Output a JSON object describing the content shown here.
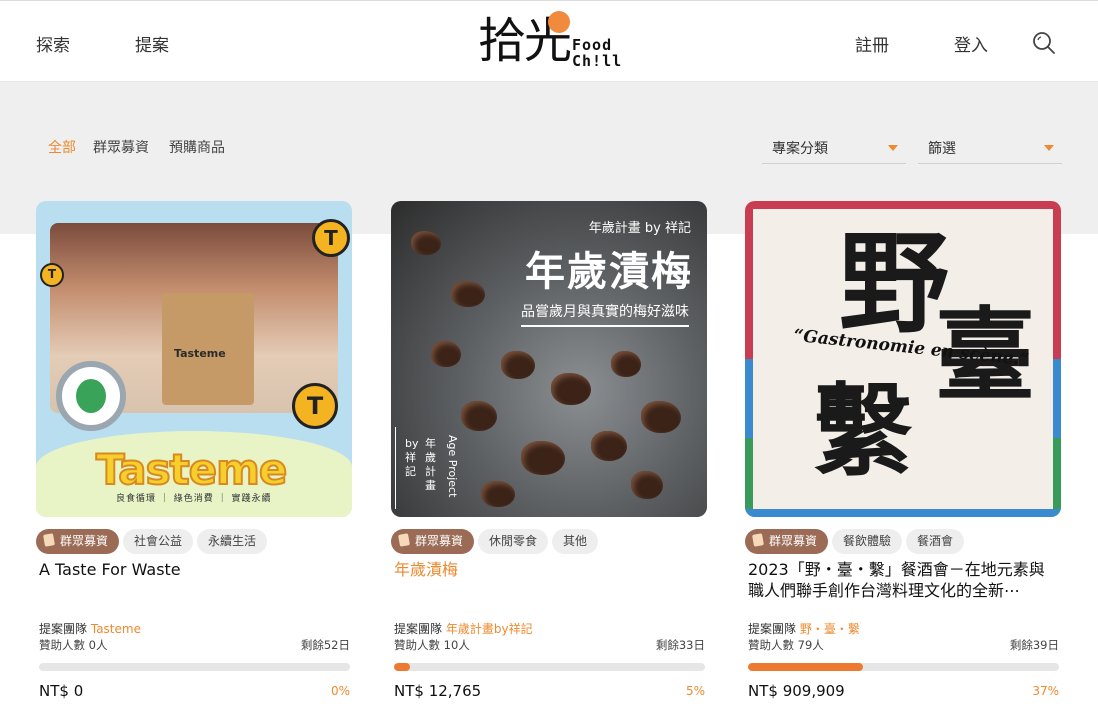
{
  "header": {
    "nav_explore": "探索",
    "nav_propose": "提案",
    "logo_zh": "拾光",
    "logo_en_1": "Food",
    "logo_en_2": "Ch!ll",
    "register": "註冊",
    "login": "登入",
    "search_icon": "search-icon"
  },
  "filters": {
    "tabs": [
      "全部",
      "群眾募資",
      "預購商品"
    ],
    "active_index": 0,
    "category_label": "專案分類",
    "filter_label": "篩選"
  },
  "colors": {
    "accent": "#ee8a2e",
    "tag_primary": "#9b6b55",
    "progress": "#ee7a32"
  },
  "cards": [
    {
      "tags": [
        "群眾募資",
        "社會公益",
        "永續生活"
      ],
      "title": "A Taste For Waste",
      "team_label": "提案團隊",
      "team_name": "Tasteme",
      "sponsors": "贊助人數 0人",
      "remaining": "剩餘52日",
      "amount": "NT$ 0",
      "percent": "0%",
      "progress": 0,
      "art": {
        "brand": "Tasteme",
        "bag_text": "Tasteme",
        "slogan": "良食循環 ｜ 綠色消費 ｜ 實踐永續",
        "coin": "T"
      }
    },
    {
      "tags": [
        "群眾募資",
        "休閒零食",
        "其他"
      ],
      "title": "年歲漬梅",
      "team_label": "提案團隊",
      "team_name": "年歲計畫by祥記",
      "sponsors": "贊助人數 10人",
      "remaining": "剩餘33日",
      "amount": "NT$ 12,765",
      "percent": "5%",
      "progress": 0.05,
      "art": {
        "top_line": "年歲計畫 by 祥記",
        "big": "年歲漬梅",
        "sub": "品嘗歲月與真實的梅好滋味",
        "vert_1": "by祥記",
        "vert_2": "年歲計畫",
        "vert_3": "Age Project"
      }
    },
    {
      "tags": [
        "群眾募資",
        "餐飲體驗",
        "餐酒會"
      ],
      "title": "2023「野・臺・繫」餐酒會－在地元素與職人們聯手創作台灣料理文化的全新⋯",
      "team_label": "提案團隊",
      "team_name": "野・臺・繫",
      "sponsors": "贊助人數 79人",
      "remaining": "剩餘39日",
      "amount": "NT$ 909,909",
      "percent": "37%",
      "progress": 0.37,
      "art": {
        "k1": "野",
        "k2": "臺",
        "k3": "繫",
        "gastro": "“Gastronomie en scène.”"
      }
    }
  ]
}
